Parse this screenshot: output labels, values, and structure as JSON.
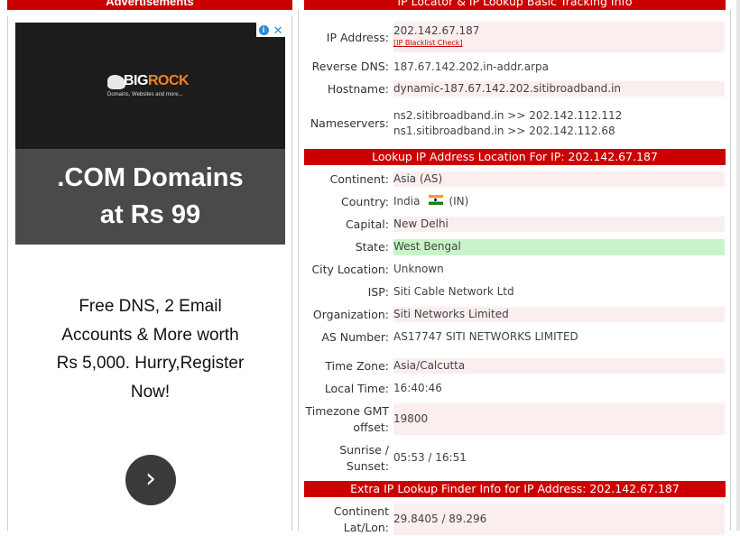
{
  "advertisement": {
    "header": "Advertisements",
    "logo_brand_a": "BIG",
    "logo_brand_b": "ROCK",
    "logo_tagline": "Domains, Websites and more...",
    "headline_line1": ".COM Domains",
    "headline_line2": "at Rs 99",
    "body_lines": [
      "Free DNS, 2 Email",
      "Accounts & More worth",
      "Rs 5,000. Hurry,Register",
      "Now!"
    ],
    "info_glyph": "i",
    "close_glyph": "✕",
    "arrow_glyph": "›"
  },
  "basic_info": {
    "header": "IP Locator & IP Lookup Basic Tracking Info",
    "ip_label": "IP Address:",
    "ip_value": "202.142.67.187",
    "blacklist_link": "[IP Blacklist Check]",
    "reverse_dns_label": "Reverse DNS:",
    "reverse_dns_value": "187.67.142.202.in-addr.arpa",
    "hostname_label": "Hostname:",
    "hostname_value": "dynamic-187.67.142.202.sitibroadband.in",
    "nameservers_label": "Nameservers:",
    "nameserver_1": "ns2.sitibroadband.in >> 202.142.112.112",
    "nameserver_2": "ns1.sitibroadband.in >> 202.142.112.68"
  },
  "location": {
    "header": "Lookup IP Address Location For IP: 202.142.67.187",
    "continent_label": "Continent:",
    "continent_value": "Asia (AS)",
    "country_label": "Country:",
    "country_name": "India",
    "country_code": "(IN)",
    "capital_label": "Capital:",
    "capital_value": "New Delhi",
    "state_label": "State:",
    "state_value": "West Bengal",
    "city_label": "City Location:",
    "city_value": "Unknown",
    "isp_label": "ISP:",
    "isp_value": "Siti Cable Network Ltd",
    "org_label": "Organization:",
    "org_value": "Siti Networks Limited",
    "as_label": "AS Number:",
    "as_value": "AS17747 SITI NETWORKS LIMITED",
    "timezone_label": "Time Zone:",
    "timezone_value": "Asia/Calcutta",
    "local_time_label": "Local Time:",
    "local_time_value": "16:40:46",
    "gmt_label_line1": "Timezone GMT",
    "gmt_label_line2": "offset:",
    "gmt_value": "19800",
    "sun_label_line1": "Sunrise /",
    "sun_label_line2": "Sunset:",
    "sun_value": "05:53 / 16:51"
  },
  "extra_info": {
    "header": "Extra IP Lookup Finder Info for IP Address: 202.142.67.187",
    "latlon_label_line1": "Continent",
    "latlon_label_line2": "Lat/Lon:",
    "latlon_value": "29.8405 / 89.296"
  }
}
